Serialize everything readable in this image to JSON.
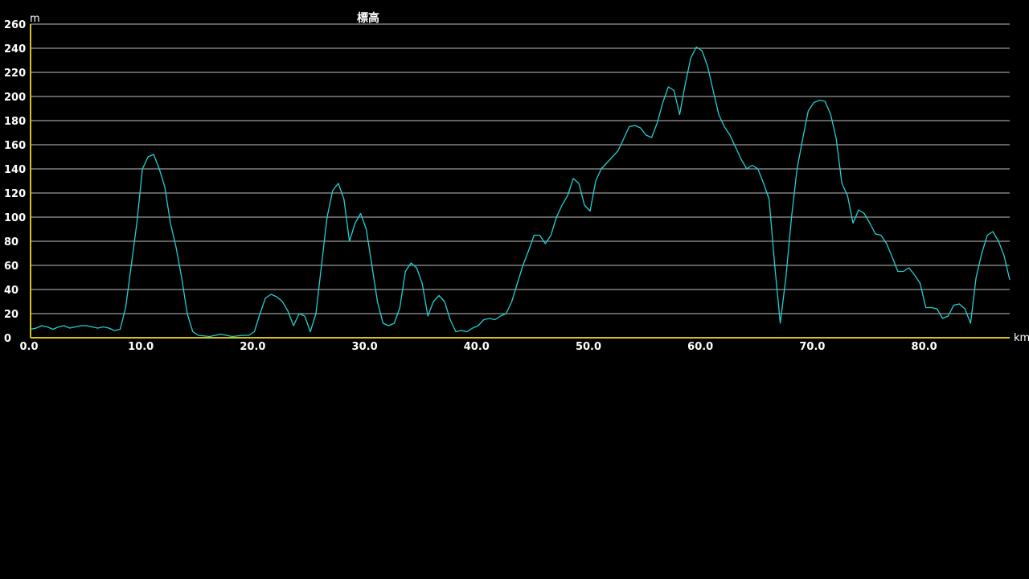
{
  "chart_data": {
    "type": "line",
    "title": "標高",
    "y_unit": "m",
    "x_unit": "km",
    "xlim": [
      0,
      87.5
    ],
    "ylim": [
      0,
      260
    ],
    "x_ticks": [
      0,
      10,
      20,
      30,
      40,
      50,
      60,
      70,
      80
    ],
    "x_tick_labels": [
      "0.0",
      "10.0",
      "20.0",
      "30.0",
      "40.0",
      "50.0",
      "60.0",
      "70.0",
      "80.0"
    ],
    "y_ticks": [
      0,
      20,
      40,
      60,
      80,
      100,
      120,
      140,
      160,
      180,
      200,
      220,
      240,
      260
    ],
    "y_tick_labels": [
      "0",
      "20",
      "40",
      "60",
      "80",
      "100",
      "120",
      "140",
      "160",
      "180",
      "200",
      "220",
      "240",
      "260"
    ],
    "grid": true,
    "colors": {
      "background": "#000000",
      "grid": "#bfbfbf",
      "axis": "#d4c21a",
      "line": "#23cfcf",
      "text": "#ffffff"
    },
    "series": [
      {
        "values": [
          [
            0,
            7
          ],
          [
            0.5,
            8
          ],
          [
            1,
            10
          ],
          [
            1.5,
            9
          ],
          [
            2,
            7
          ],
          [
            2.5,
            9
          ],
          [
            3,
            10
          ],
          [
            3.5,
            8
          ],
          [
            4,
            9
          ],
          [
            4.5,
            10
          ],
          [
            5,
            10
          ],
          [
            5.5,
            9
          ],
          [
            6,
            8
          ],
          [
            6.5,
            9
          ],
          [
            7,
            8
          ],
          [
            7.5,
            6
          ],
          [
            8,
            7
          ],
          [
            8.5,
            25
          ],
          [
            9,
            60
          ],
          [
            9.5,
            95
          ],
          [
            10,
            140
          ],
          [
            10.5,
            150
          ],
          [
            11,
            152
          ],
          [
            11.5,
            140
          ],
          [
            12,
            125
          ],
          [
            12.5,
            95
          ],
          [
            13,
            75
          ],
          [
            13.5,
            50
          ],
          [
            14,
            20
          ],
          [
            14.5,
            5
          ],
          [
            15,
            2
          ],
          [
            16,
            1
          ],
          [
            17,
            3
          ],
          [
            17.5,
            2
          ],
          [
            18,
            1
          ],
          [
            19,
            2
          ],
          [
            19.5,
            2
          ],
          [
            20,
            5
          ],
          [
            20.5,
            20
          ],
          [
            21,
            33
          ],
          [
            21.5,
            36
          ],
          [
            22,
            34
          ],
          [
            22.5,
            30
          ],
          [
            23,
            22
          ],
          [
            23.5,
            10
          ],
          [
            24,
            20
          ],
          [
            24.5,
            18
          ],
          [
            25,
            5
          ],
          [
            25.5,
            20
          ],
          [
            26,
            60
          ],
          [
            26.5,
            100
          ],
          [
            27,
            122
          ],
          [
            27.5,
            128
          ],
          [
            28,
            115
          ],
          [
            28.5,
            80
          ],
          [
            29,
            95
          ],
          [
            29.5,
            103
          ],
          [
            30,
            90
          ],
          [
            30.5,
            60
          ],
          [
            31,
            30
          ],
          [
            31.5,
            12
          ],
          [
            32,
            10
          ],
          [
            32.5,
            12
          ],
          [
            33,
            25
          ],
          [
            33.5,
            55
          ],
          [
            34,
            62
          ],
          [
            34.5,
            58
          ],
          [
            35,
            45
          ],
          [
            35.5,
            18
          ],
          [
            36,
            30
          ],
          [
            36.5,
            35
          ],
          [
            37,
            30
          ],
          [
            37.5,
            15
          ],
          [
            38,
            5
          ],
          [
            38.5,
            6
          ],
          [
            39,
            5
          ],
          [
            39.5,
            8
          ],
          [
            40,
            10
          ],
          [
            40.5,
            15
          ],
          [
            41,
            16
          ],
          [
            41.5,
            15
          ],
          [
            42,
            18
          ],
          [
            42.5,
            20
          ],
          [
            43,
            30
          ],
          [
            43.5,
            45
          ],
          [
            44,
            60
          ],
          [
            44.5,
            72
          ],
          [
            45,
            85
          ],
          [
            45.5,
            85
          ],
          [
            46,
            78
          ],
          [
            46.5,
            85
          ],
          [
            47,
            100
          ],
          [
            47.5,
            110
          ],
          [
            48,
            118
          ],
          [
            48.5,
            132
          ],
          [
            49,
            128
          ],
          [
            49.5,
            110
          ],
          [
            50,
            105
          ],
          [
            50.5,
            130
          ],
          [
            51,
            140
          ],
          [
            51.5,
            145
          ],
          [
            52,
            150
          ],
          [
            52.5,
            155
          ],
          [
            53,
            165
          ],
          [
            53.5,
            175
          ],
          [
            54,
            176
          ],
          [
            54.5,
            174
          ],
          [
            55,
            168
          ],
          [
            55.5,
            166
          ],
          [
            56,
            178
          ],
          [
            56.5,
            195
          ],
          [
            57,
            208
          ],
          [
            57.5,
            205
          ],
          [
            58,
            185
          ],
          [
            58.5,
            210
          ],
          [
            59,
            232
          ],
          [
            59.5,
            241
          ],
          [
            60,
            238
          ],
          [
            60.5,
            225
          ],
          [
            61,
            205
          ],
          [
            61.5,
            185
          ],
          [
            62,
            175
          ],
          [
            62.5,
            168
          ],
          [
            63,
            158
          ],
          [
            63.5,
            148
          ],
          [
            64,
            140
          ],
          [
            64.5,
            143
          ],
          [
            65,
            140
          ],
          [
            65.5,
            128
          ],
          [
            66,
            115
          ],
          [
            66.5,
            60
          ],
          [
            67,
            12
          ],
          [
            67.5,
            50
          ],
          [
            68,
            100
          ],
          [
            68.5,
            140
          ],
          [
            69,
            165
          ],
          [
            69.5,
            188
          ],
          [
            70,
            195
          ],
          [
            70.5,
            197
          ],
          [
            71,
            196
          ],
          [
            71.5,
            185
          ],
          [
            72,
            165
          ],
          [
            72.5,
            128
          ],
          [
            73,
            118
          ],
          [
            73.5,
            95
          ],
          [
            74,
            106
          ],
          [
            74.5,
            103
          ],
          [
            75,
            95
          ],
          [
            75.5,
            86
          ],
          [
            76,
            85
          ],
          [
            76.5,
            78
          ],
          [
            77,
            67
          ],
          [
            77.5,
            55
          ],
          [
            78,
            55
          ],
          [
            78.5,
            58
          ],
          [
            79,
            52
          ],
          [
            79.5,
            45
          ],
          [
            80,
            25
          ],
          [
            80.5,
            25
          ],
          [
            81,
            24
          ],
          [
            81.5,
            16
          ],
          [
            82,
            18
          ],
          [
            82.5,
            27
          ],
          [
            83,
            28
          ],
          [
            83.5,
            24
          ],
          [
            84,
            12
          ],
          [
            84.5,
            50
          ],
          [
            85,
            70
          ],
          [
            85.5,
            85
          ],
          [
            86,
            88
          ],
          [
            86.5,
            80
          ],
          [
            87,
            68
          ],
          [
            87.5,
            48
          ]
        ]
      }
    ]
  }
}
